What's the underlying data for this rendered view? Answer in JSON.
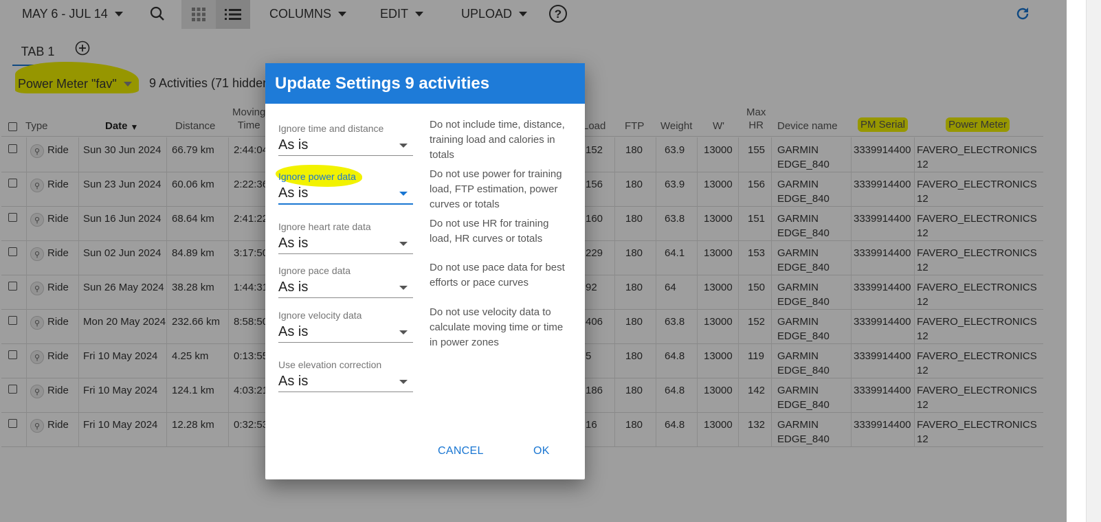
{
  "toolbar": {
    "date_range": "MAY 6 - JUL 14",
    "columns": "COLUMNS",
    "edit": "EDIT",
    "upload": "UPLOAD"
  },
  "tabs": [
    {
      "label": "TAB 1"
    }
  ],
  "filter": {
    "name": "Power Meter \"fav\"",
    "count": "9 Activities (71 hidden"
  },
  "table": {
    "headers": {
      "type": "Type",
      "date": "Date",
      "distance": "Distance",
      "moving_1": "Moving",
      "moving_2": "Time",
      "load": "Load",
      "ftp": "FTP",
      "weight": "Weight",
      "wprime": "W'",
      "maxhr_1": "Max",
      "maxhr_2": "HR",
      "device": "Device name",
      "pm_serial": "PM Serial",
      "power_meter": "Power Meter"
    },
    "rows": [
      {
        "type": "Ride",
        "date": "Sun 30 Jun 2024",
        "distance": "66.79 km",
        "time": "2:44:04",
        "load": "152",
        "ftp": "180",
        "weight": "63.9",
        "wprime": "13000",
        "maxhr": "155",
        "device1": "GARMIN",
        "device2": "EDGE_840",
        "serial": "3339914400",
        "pm": "FAVERO_ELECTRONICS 12"
      },
      {
        "type": "Ride",
        "date": "Sun 23 Jun 2024",
        "distance": "60.06 km",
        "time": "2:22:36",
        "load": "156",
        "ftp": "180",
        "weight": "63.9",
        "wprime": "13000",
        "maxhr": "156",
        "device1": "GARMIN",
        "device2": "EDGE_840",
        "serial": "3339914400",
        "pm": "FAVERO_ELECTRONICS 12"
      },
      {
        "type": "Ride",
        "date": "Sun 16 Jun 2024",
        "distance": "68.64 km",
        "time": "2:41:22",
        "load": "160",
        "ftp": "180",
        "weight": "63.8",
        "wprime": "13000",
        "maxhr": "151",
        "device1": "GARMIN",
        "device2": "EDGE_840",
        "serial": "3339914400",
        "pm": "FAVERO_ELECTRONICS 12"
      },
      {
        "type": "Ride",
        "date": "Sun 02 Jun 2024",
        "distance": "84.89 km",
        "time": "3:17:50",
        "load": "229",
        "ftp": "180",
        "weight": "64.1",
        "wprime": "13000",
        "maxhr": "153",
        "device1": "GARMIN",
        "device2": "EDGE_840",
        "serial": "3339914400",
        "pm": "FAVERO_ELECTRONICS 12"
      },
      {
        "type": "Ride",
        "date": "Sun 26 May 2024",
        "distance": "38.28 km",
        "time": "1:44:31",
        "load": "92",
        "ftp": "180",
        "weight": "64",
        "wprime": "13000",
        "maxhr": "150",
        "device1": "GARMIN",
        "device2": "EDGE_840",
        "serial": "3339914400",
        "pm": "FAVERO_ELECTRONICS 12"
      },
      {
        "type": "Ride",
        "date": "Mon 20 May 2024",
        "distance": "232.66 km",
        "time": "8:58:50",
        "load": "406",
        "ftp": "180",
        "weight": "63.8",
        "wprime": "13000",
        "maxhr": "152",
        "device1": "GARMIN",
        "device2": "EDGE_840",
        "serial": "3339914400",
        "pm": "FAVERO_ELECTRONICS 12"
      },
      {
        "type": "Ride",
        "date": "Fri 10 May 2024",
        "distance": "4.25 km",
        "time": "0:13:55",
        "load": "5",
        "ftp": "180",
        "weight": "64.8",
        "wprime": "13000",
        "maxhr": "119",
        "device1": "GARMIN",
        "device2": "EDGE_840",
        "serial": "3339914400",
        "pm": "FAVERO_ELECTRONICS 12"
      },
      {
        "type": "Ride",
        "date": "Fri 10 May 2024",
        "distance": "124.1 km",
        "time": "4:03:21",
        "load": "186",
        "ftp": "180",
        "weight": "64.8",
        "wprime": "13000",
        "maxhr": "142",
        "device1": "GARMIN",
        "device2": "EDGE_840",
        "serial": "3339914400",
        "pm": "FAVERO_ELECTRONICS 12"
      },
      {
        "type": "Ride",
        "date": "Fri 10 May 2024",
        "distance": "12.28 km",
        "time": "0:32:53",
        "load": "16",
        "ftp": "180",
        "weight": "64.8",
        "wprime": "13000",
        "maxhr": "132",
        "device1": "GARMIN",
        "device2": "EDGE_840",
        "serial": "3339914400",
        "pm": "FAVERO_ELECTRONICS 12"
      }
    ]
  },
  "dialog": {
    "title": "Update Settings 9 activities",
    "fields": [
      {
        "label": "Ignore time and distance",
        "value": "As is",
        "desc": "Do not include time, distance, training load and calories in totals"
      },
      {
        "label": "Ignore power data",
        "value": "As is",
        "desc": "Do not use power for training load, FTP estimation, power curves or totals"
      },
      {
        "label": "Ignore heart rate data",
        "value": "As is",
        "desc": "Do not use HR for training load, HR curves or totals"
      },
      {
        "label": "Ignore pace data",
        "value": "As is",
        "desc": "Do not use pace data for best efforts or pace curves"
      },
      {
        "label": "Ignore velocity data",
        "value": "As is",
        "desc": "Do not use velocity data to calculate moving time or time in power zones"
      },
      {
        "label": "Use elevation correction",
        "value": "As is"
      }
    ],
    "cancel": "CANCEL",
    "ok": "OK"
  },
  "colors": {
    "accent": "#1976d2",
    "dialog_header": "#1e7bd8",
    "highlighter": "#f2f200"
  }
}
